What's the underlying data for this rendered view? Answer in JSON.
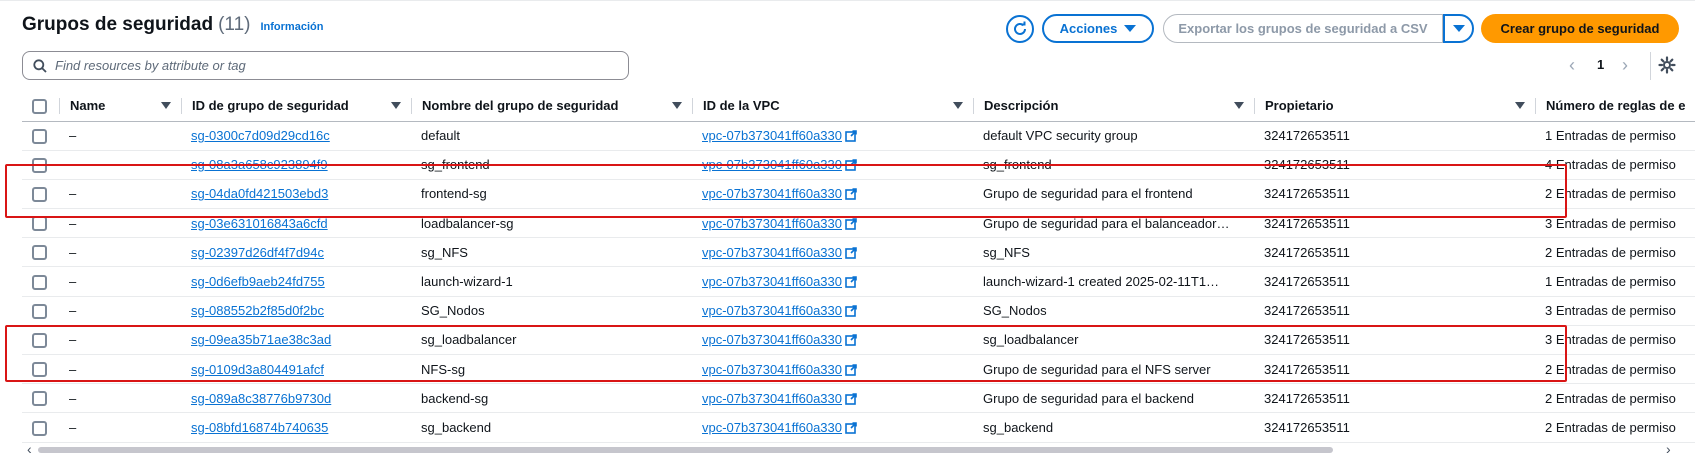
{
  "header": {
    "title": "Grupos de seguridad",
    "count": "(11)",
    "info_link": "Información"
  },
  "toolbar": {
    "actions_label": "Acciones",
    "export_label": "Exportar los grupos de seguridad a CSV",
    "create_label": "Crear grupo de seguridad"
  },
  "search": {
    "placeholder": "Find resources by attribute or tag",
    "value": ""
  },
  "pagination": {
    "current_page": "1"
  },
  "table": {
    "columns": [
      "Name",
      "ID de grupo de seguridad",
      "Nombre del grupo de seguridad",
      "ID de la VPC",
      "Descripción",
      "Propietario",
      "Número de reglas de e"
    ],
    "rows": [
      {
        "name": "–",
        "sg_id": "sg-0300c7d09d29cd16c",
        "sg_name": "default",
        "vpc": "vpc-07b373041ff60a330",
        "desc": "default VPC security group",
        "owner": "324172653511",
        "rules": "1 Entradas de permiso"
      },
      {
        "name": "–",
        "sg_id": "sg-08a3a658c923894f9",
        "sg_name": "sg_frontend",
        "vpc": "vpc-07b373041ff60a330",
        "desc": "sg_frontend",
        "owner": "324172653511",
        "rules": "4 Entradas de permiso"
      },
      {
        "name": "–",
        "sg_id": "sg-04da0fd421503ebd3",
        "sg_name": "frontend-sg",
        "vpc": "vpc-07b373041ff60a330",
        "desc": "Grupo de seguridad para el frontend",
        "owner": "324172653511",
        "rules": "2 Entradas de permiso"
      },
      {
        "name": "–",
        "sg_id": "sg-03e631016843a6cfd",
        "sg_name": "loadbalancer-sg",
        "vpc": "vpc-07b373041ff60a330",
        "desc": "Grupo de seguridad para el balanceador…",
        "owner": "324172653511",
        "rules": "3 Entradas de permiso"
      },
      {
        "name": "–",
        "sg_id": "sg-02397d26df4f7d94c",
        "sg_name": "sg_NFS",
        "vpc": "vpc-07b373041ff60a330",
        "desc": "sg_NFS",
        "owner": "324172653511",
        "rules": "2 Entradas de permiso"
      },
      {
        "name": "–",
        "sg_id": "sg-0d6efb9aeb24fd755",
        "sg_name": "launch-wizard-1",
        "vpc": "vpc-07b373041ff60a330",
        "desc": "launch-wizard-1 created 2025-02-11T1…",
        "owner": "324172653511",
        "rules": "1 Entradas de permiso"
      },
      {
        "name": "–",
        "sg_id": "sg-088552b2f85d0f2bc",
        "sg_name": "SG_Nodos",
        "vpc": "vpc-07b373041ff60a330",
        "desc": "SG_Nodos",
        "owner": "324172653511",
        "rules": "3 Entradas de permiso"
      },
      {
        "name": "–",
        "sg_id": "sg-09ea35b71ae38c3ad",
        "sg_name": "sg_loadbalancer",
        "vpc": "vpc-07b373041ff60a330",
        "desc": "sg_loadbalancer",
        "owner": "324172653511",
        "rules": "3 Entradas de permiso"
      },
      {
        "name": "–",
        "sg_id": "sg-0109d3a804491afcf",
        "sg_name": "NFS-sg",
        "vpc": "vpc-07b373041ff60a330",
        "desc": "Grupo de seguridad para el NFS server",
        "owner": "324172653511",
        "rules": "2 Entradas de permiso"
      },
      {
        "name": "–",
        "sg_id": "sg-089a8c38776b9730d",
        "sg_name": "backend-sg",
        "vpc": "vpc-07b373041ff60a330",
        "desc": "Grupo de seguridad para el backend",
        "owner": "324172653511",
        "rules": "2 Entradas de permiso"
      },
      {
        "name": "–",
        "sg_id": "sg-08bfd16874b740635",
        "sg_name": "sg_backend",
        "vpc": "vpc-07b373041ff60a330",
        "desc": "sg_backend",
        "owner": "324172653511",
        "rules": "2 Entradas de permiso"
      }
    ]
  },
  "colors": {
    "link": "#0972d3",
    "primary_button": "#ff9900",
    "highlight_box": "#d91515"
  },
  "icons": {
    "refresh": "refresh-icon",
    "actions_caret": "caret-down-icon",
    "search": "search-icon",
    "external_link": "external-link-icon",
    "settings": "gear-icon"
  }
}
